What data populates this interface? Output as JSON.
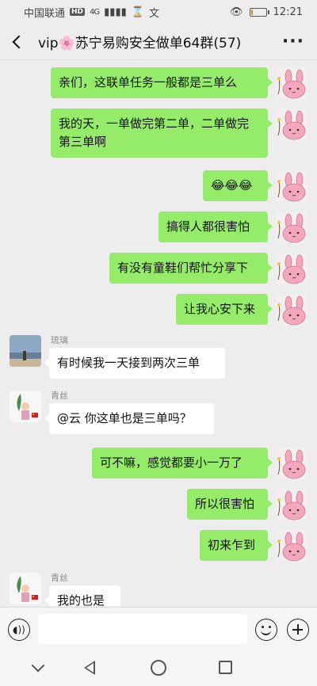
{
  "status_bar": {
    "carrier": "中国联通",
    "network_badge": "HD",
    "signal": "4G",
    "time": "12:21",
    "battery_fraction": 0.15
  },
  "header": {
    "title": "vip🌸苏宁易购安全做单64群(57)",
    "more_label": "···"
  },
  "messages": [
    {
      "side": "me",
      "text": "亲们，这联单任务一般都是三单么"
    },
    {
      "side": "me",
      "text": "我的天，一单做完第二单，二单做完第三单啊"
    },
    {
      "side": "me",
      "text": "😂😂😂"
    },
    {
      "side": "me",
      "text": "搞得人都很害怕"
    },
    {
      "side": "me",
      "text": "有没有童鞋们帮忙分享下"
    },
    {
      "side": "me",
      "text": "让我心安下来"
    },
    {
      "side": "other",
      "sender": "琉璃",
      "text": "有时候我一天接到两次三单"
    },
    {
      "side": "other",
      "sender": "青丝",
      "text": "@云  你这单也是三单吗？"
    },
    {
      "side": "me",
      "text": "可不嘛，感觉都要小一万了"
    },
    {
      "side": "me",
      "text": "所以很害怕"
    },
    {
      "side": "me",
      "text": "初来乍到"
    },
    {
      "side": "other",
      "sender": "青丝",
      "text": "我的也是"
    }
  ],
  "input_bar": {
    "voice_icon": "voice-icon",
    "emoji_icon": "emoji-icon",
    "plus_icon": "plus-icon"
  },
  "colors": {
    "my_bubble": "#95ec69",
    "other_bubble": "#ffffff",
    "background": "#ededed"
  }
}
